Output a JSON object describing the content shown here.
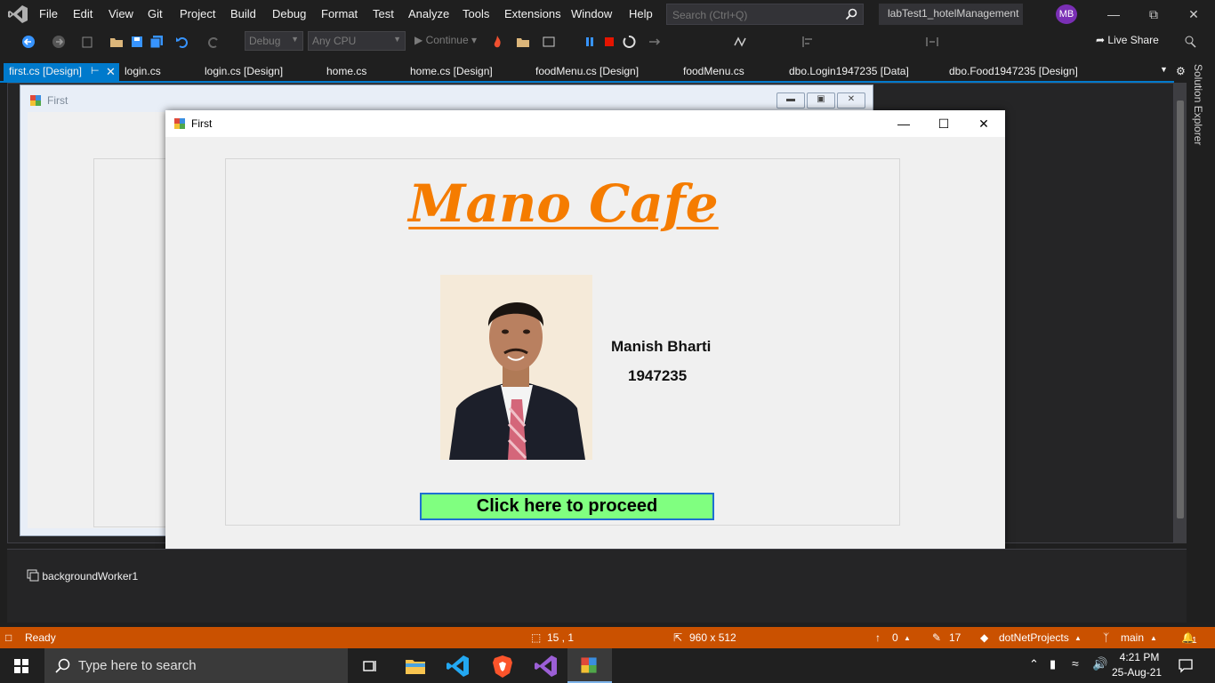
{
  "menubar": {
    "items": [
      "File",
      "Edit",
      "View",
      "Git",
      "Project",
      "Build",
      "Debug",
      "Format",
      "Test",
      "Analyze",
      "Tools",
      "Extensions",
      "Window",
      "Help"
    ],
    "search_placeholder": "Search (Ctrl+Q)",
    "project_title": "labTest1_hotelManagement",
    "avatar_initials": "MB"
  },
  "toolbar": {
    "config": "Debug",
    "platform": "Any CPU",
    "continue_label": "Continue",
    "liveshare_label": "Live Share"
  },
  "tabs": [
    {
      "label": "first.cs [Design]",
      "active": true
    },
    {
      "label": "login.cs"
    },
    {
      "label": "login.cs [Design]"
    },
    {
      "label": "home.cs"
    },
    {
      "label": "home.cs [Design]"
    },
    {
      "label": "foodMenu.cs [Design]"
    },
    {
      "label": "foodMenu.cs"
    },
    {
      "label": "dbo.Login1947235 [Data]"
    },
    {
      "label": "dbo.Food1947235 [Design]"
    }
  ],
  "side_panel": {
    "solution_explorer": "Solution Explorer"
  },
  "designer": {
    "form_title": "First"
  },
  "running_form": {
    "title": "First",
    "cafe_name": "Mano Cafe",
    "person_name": "Manish Bharti",
    "person_id": "1947235",
    "proceed_label": "Click here to proceed",
    "proceed_color": "#80ff80",
    "title_color": "#f57c00"
  },
  "tray": {
    "component": "backgroundWorker1"
  },
  "statusbar": {
    "ready": "Ready",
    "position": "15 , 1",
    "size": "960 x 512",
    "up_count": "0",
    "edit_count": "17",
    "repo": "dotNetProjects",
    "branch": "main",
    "notifications": "1"
  },
  "taskbar": {
    "search_placeholder": "Type here to search",
    "time": "4:21 PM",
    "date": "25-Aug-21"
  },
  "colors": {
    "accent": "#007acc",
    "status": "#ca5100"
  }
}
